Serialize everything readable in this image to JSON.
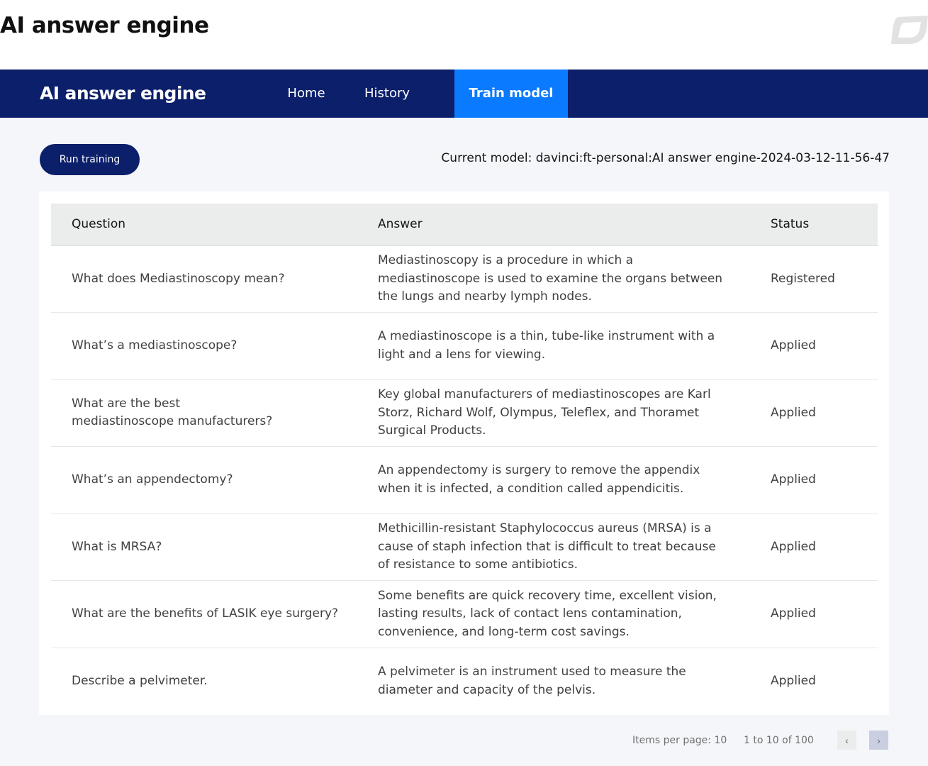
{
  "page": {
    "title": "AI answer engine",
    "corner_logo_icon": "leaf-logo-icon"
  },
  "navbar": {
    "brand": "AI answer engine",
    "items": [
      {
        "label": "Home",
        "active": false
      },
      {
        "label": "History",
        "active": false
      },
      {
        "label": "Train model",
        "active": true
      }
    ],
    "colors": {
      "background": "#0b1f6b",
      "active": "#0a7aff"
    }
  },
  "toolbar": {
    "run_training_label": "Run training",
    "current_model_text": "Current model: davinci:ft-personal:AI answer engine-2024-03-12-11-56-47"
  },
  "table": {
    "columns": [
      "Question",
      "Answer",
      "Status"
    ],
    "rows": [
      {
        "question": "What does Mediastinoscopy mean?",
        "answer": "Mediastinoscopy is a procedure in which a\nmediastinoscope is used to examine the organs between\nthe lungs and nearby lymph nodes.",
        "status": "Registered"
      },
      {
        "question": "What’s a mediastinoscope?",
        "answer": "A mediastinoscope is a thin, tube-like instrument with a\nlight and a lens for viewing.",
        "status": "Applied"
      },
      {
        "question": "What are the best\nmediastinoscope manufacturers?",
        "answer": "Key global manufacturers of mediastinoscopes are Karl\nStorz, Richard Wolf, Olympus, Teleflex, and Thoramet\nSurgical Products.",
        "status": "Applied"
      },
      {
        "question": "What’s an appendectomy?",
        "answer": "An appendectomy is surgery to remove the appendix\nwhen it is infected, a condition called appendicitis.",
        "status": "Applied"
      },
      {
        "question": "What is MRSA?",
        "answer": "Methicillin-resistant Staphylococcus aureus (MRSA) is a\ncause of staph infection that is difficult to treat because\nof resistance to some antibiotics.",
        "status": "Applied"
      },
      {
        "question": "What are the benefits of LASIK eye surgery?",
        "answer": "Some benefits are quick recovery time, excellent vision,\nlasting results, lack of contact lens contamination,\nconvenience, and long-term cost savings.",
        "status": "Applied"
      },
      {
        "question": "Describe a pelvimeter.",
        "answer": " A pelvimeter is an instrument used to measure the\ndiameter and capacity of the pelvis.",
        "status": "Applied"
      }
    ]
  },
  "pagination": {
    "items_per_page_text": "Items per page: 10",
    "range_text": "1 to 10 of 100",
    "prev_icon": "‹",
    "next_icon": "›"
  }
}
